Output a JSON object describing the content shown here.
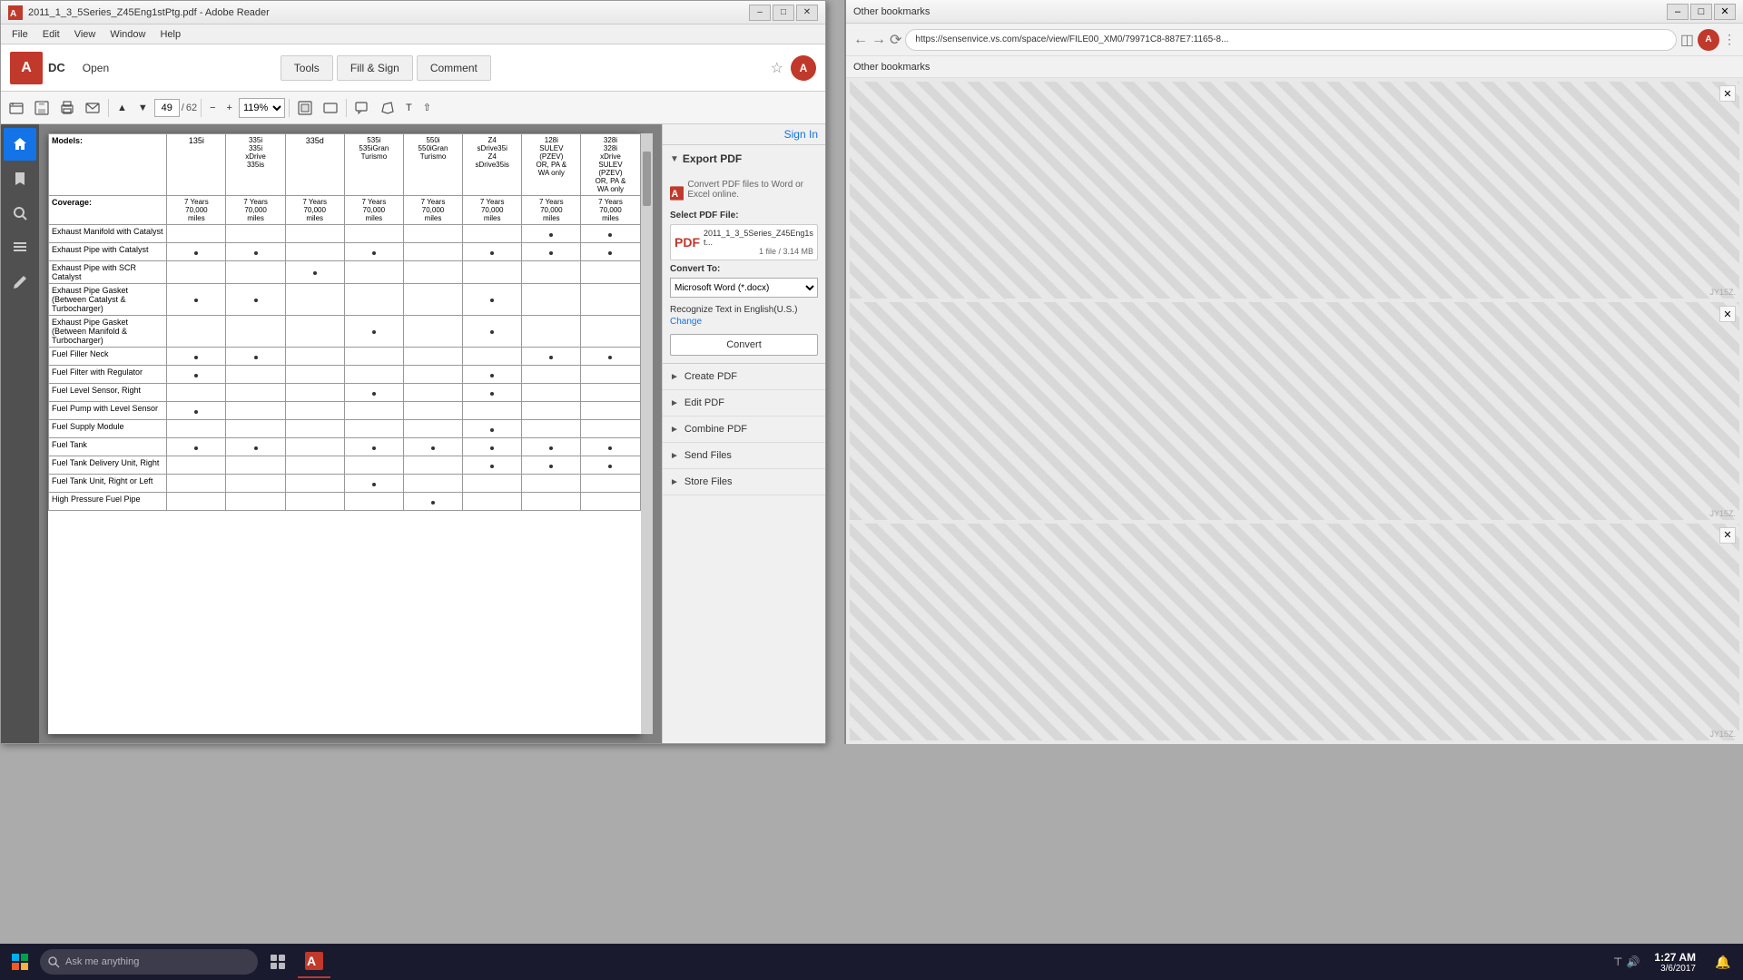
{
  "window": {
    "title": "2011_1_3_5Series_Z45Eng1stPtg.pdf - Adobe Reader",
    "icon": "pdf-icon"
  },
  "menu": {
    "items": [
      "File",
      "Edit",
      "View",
      "Window",
      "Help"
    ]
  },
  "toolbar": {
    "page_current": "49",
    "page_total": "62",
    "zoom": "119%",
    "buttons": [
      "open",
      "save",
      "print",
      "email",
      "previous",
      "next",
      "zoom-out",
      "zoom-in",
      "fit-page",
      "fit-width",
      "comment",
      "markup",
      "typewriter"
    ]
  },
  "pdf": {
    "headers": [
      "Models:",
      "135i",
      "335i\n335i\nxDrive\n335is",
      "335d",
      "535i\n535iGran\nTurismo",
      "550i\n550iGran\nTurismo",
      "Z4\nsDrive35i\nZ4\nsDrive35is",
      "128i\nSULEV\n(PZEV)\nOR, PA &\nWA only",
      "328i\n328i\nxDrive\nSULEV\n(PZEV)\nOR, PA &\nWA only"
    ],
    "coverage": "7 Years 70,000 miles",
    "rows": [
      {
        "item": "Exhaust Manifold with Catalyst",
        "dots": [
          false,
          false,
          false,
          false,
          false,
          false,
          true,
          true
        ]
      },
      {
        "item": "Exhaust Pipe with Catalyst",
        "dots": [
          true,
          true,
          false,
          true,
          false,
          true,
          true,
          true
        ]
      },
      {
        "item": "Exhaust Pipe with SCR Catalyst",
        "dots": [
          false,
          false,
          true,
          false,
          false,
          false,
          false,
          false
        ]
      },
      {
        "item": "Exhaust Pipe Gasket (Between Catalyst & Turbocharger)",
        "dots": [
          true,
          true,
          false,
          false,
          false,
          true,
          false,
          false
        ]
      },
      {
        "item": "Exhaust Pipe Gasket (Between Manifold & Turbocharger)",
        "dots": [
          false,
          false,
          false,
          true,
          false,
          true,
          false,
          false
        ]
      },
      {
        "item": "Fuel Filler Neck",
        "dots": [
          true,
          true,
          false,
          false,
          false,
          false,
          true,
          true
        ]
      },
      {
        "item": "Fuel Filter with Regulator",
        "dots": [
          true,
          false,
          false,
          false,
          false,
          true,
          false,
          false
        ]
      },
      {
        "item": "Fuel Level Sensor, Right",
        "dots": [
          false,
          false,
          false,
          true,
          false,
          true,
          false,
          false
        ]
      },
      {
        "item": "Fuel Pump with Level Sensor",
        "dots": [
          true,
          false,
          false,
          false,
          false,
          false,
          false,
          false
        ]
      },
      {
        "item": "Fuel Supply Module",
        "dots": [
          false,
          false,
          false,
          false,
          false,
          true,
          false,
          false
        ]
      },
      {
        "item": "Fuel Tank",
        "dots": [
          true,
          true,
          false,
          true,
          true,
          true,
          true,
          true
        ]
      },
      {
        "item": "Fuel Tank Delivery Unit, Right",
        "dots": [
          false,
          false,
          false,
          false,
          false,
          true,
          true,
          true
        ]
      },
      {
        "item": "Fuel Tank Unit, Right or Left",
        "dots": [
          false,
          false,
          false,
          true,
          false,
          false,
          false,
          false
        ]
      },
      {
        "item": "High Pressure Fuel Pipe",
        "dots": [
          false,
          false,
          false,
          false,
          true,
          false,
          false,
          false
        ]
      }
    ]
  },
  "right_panel": {
    "sign_in": "Sign In",
    "export_pdf": {
      "title": "Export PDF",
      "description": "Convert PDF files to Word or Excel online.",
      "select_file_label": "Select PDF File:",
      "file_name": "2011_1_3_5Series_Z45Eng1st...",
      "file_size": "1 file / 3.14 MB",
      "convert_to_label": "Convert To:",
      "convert_to_option": "Microsoft Word (*.docx)",
      "recognize_text": "Recognize Text in English(U.S.)",
      "change_link": "Change",
      "convert_btn": "Convert"
    },
    "sections": [
      {
        "label": "Create PDF",
        "icon": "create-icon"
      },
      {
        "label": "Edit PDF",
        "icon": "edit-icon"
      },
      {
        "label": "Combine PDF",
        "icon": "combine-icon"
      },
      {
        "label": "Send Files",
        "icon": "send-icon"
      },
      {
        "label": "Store Files",
        "icon": "store-icon"
      }
    ]
  },
  "adobe_bar": {
    "tools": [
      "Tools",
      "Fill & Sign",
      "Comment"
    ]
  },
  "taskbar": {
    "search_placeholder": "Ask me anything",
    "time": "1:27 AM",
    "date": "3/6/2017"
  },
  "second_window": {
    "title": "Other bookmarks"
  },
  "url_bar": {
    "value": "https://sensenvice.vs.com/space/view/FILE00_XM0/79971C8-887E7:1165-8..."
  }
}
